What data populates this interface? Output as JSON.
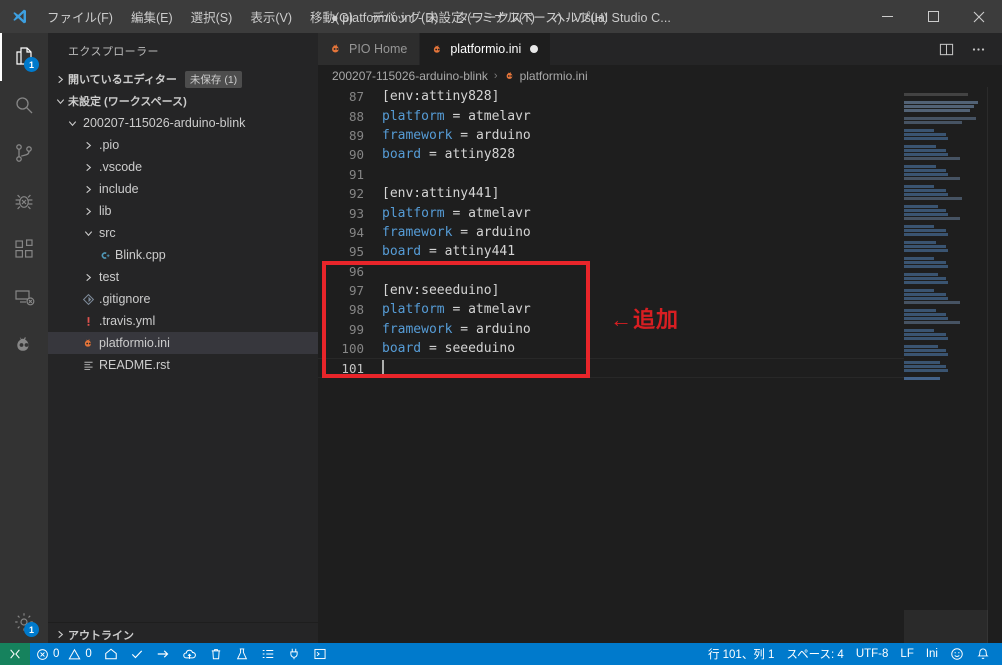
{
  "titlebar": {
    "title": "● platformio.ini - 未設定 (ワークスペース) - Visual Studio C...",
    "menu": [
      {
        "label": "ファイル(F)",
        "name": "menu-file"
      },
      {
        "label": "編集(E)",
        "name": "menu-edit"
      },
      {
        "label": "選択(S)",
        "name": "menu-selection"
      },
      {
        "label": "表示(V)",
        "name": "menu-view"
      },
      {
        "label": "移動(G)",
        "name": "menu-go"
      },
      {
        "label": "デバッグ(D)",
        "name": "menu-debug"
      },
      {
        "label": "ターミナル(T)",
        "name": "menu-terminal"
      },
      {
        "label": "ヘルプ(H)",
        "name": "menu-help"
      }
    ],
    "window_controls": {
      "minimize": "minimize-icon",
      "maximize": "maximize-icon",
      "close": "close-icon"
    }
  },
  "activitybar": {
    "items": [
      {
        "name": "explorer",
        "icon": "files-icon",
        "active": true,
        "badge": "1"
      },
      {
        "name": "search",
        "icon": "search-icon",
        "active": false,
        "badge": ""
      },
      {
        "name": "source-control",
        "icon": "source-control-icon",
        "active": false,
        "badge": ""
      },
      {
        "name": "debug",
        "icon": "debug-icon",
        "active": false,
        "badge": ""
      },
      {
        "name": "extensions",
        "icon": "extensions-icon",
        "active": false,
        "badge": ""
      },
      {
        "name": "remote-explorer",
        "icon": "remote-explorer-icon",
        "active": false,
        "badge": ""
      },
      {
        "name": "platformio",
        "icon": "platformio-alien-icon",
        "active": false,
        "badge": ""
      }
    ],
    "bottom": [
      {
        "name": "manage-settings",
        "icon": "gear-icon",
        "badge": "1"
      }
    ]
  },
  "sidebar": {
    "title": "エクスプローラー",
    "open_editors": {
      "label": "開いているエディター",
      "badge": "未保存 (1)",
      "expanded": false
    },
    "workspace": {
      "label": "未設定 (ワークスペース)",
      "expanded": true
    },
    "tree": [
      {
        "label": "200207-115026-arduino-blink",
        "depth": 1,
        "kind": "folder",
        "expanded": true,
        "icon": "chevron-down-icon",
        "selected": false
      },
      {
        "label": ".pio",
        "depth": 2,
        "kind": "folder",
        "expanded": false,
        "icon": "chevron-right-icon",
        "selected": false
      },
      {
        "label": ".vscode",
        "depth": 2,
        "kind": "folder",
        "expanded": false,
        "icon": "chevron-right-icon",
        "selected": false
      },
      {
        "label": "include",
        "depth": 2,
        "kind": "folder",
        "expanded": false,
        "icon": "chevron-right-icon",
        "selected": false
      },
      {
        "label": "lib",
        "depth": 2,
        "kind": "folder",
        "expanded": false,
        "icon": "chevron-right-icon",
        "selected": false
      },
      {
        "label": "src",
        "depth": 2,
        "kind": "folder",
        "expanded": true,
        "icon": "chevron-down-icon",
        "selected": false
      },
      {
        "label": "Blink.cpp",
        "depth": 3,
        "kind": "file",
        "icon": "cpp-file-icon",
        "selected": false
      },
      {
        "label": "test",
        "depth": 2,
        "kind": "folder",
        "expanded": false,
        "icon": "chevron-right-icon",
        "selected": false
      },
      {
        "label": ".gitignore",
        "depth": 2,
        "kind": "file",
        "icon": "git-file-icon",
        "selected": false
      },
      {
        "label": ".travis.yml",
        "depth": 2,
        "kind": "file",
        "icon": "travis-file-icon",
        "selected": false
      },
      {
        "label": "platformio.ini",
        "depth": 2,
        "kind": "file",
        "icon": "platformio-file-icon",
        "selected": true
      },
      {
        "label": "README.rst",
        "depth": 2,
        "kind": "file",
        "icon": "text-file-icon",
        "selected": false
      }
    ],
    "outline": {
      "label": "アウトライン",
      "expanded": false
    }
  },
  "editor": {
    "tabs": [
      {
        "label": "PIO Home",
        "icon": "platformio-alien-icon",
        "active": false,
        "dirty": false
      },
      {
        "label": "platformio.ini",
        "icon": "platformio-file-icon",
        "active": true,
        "dirty": true
      }
    ],
    "tab_actions": [
      {
        "name": "split-editor-button",
        "icon": "split-editor-icon"
      },
      {
        "name": "more-actions-button",
        "icon": "ellipsis-icon"
      }
    ],
    "breadcrumb": [
      "200207-115026-arduino-blink",
      "platformio.ini"
    ],
    "breadcrumb_icon": "platformio-file-icon",
    "lines": [
      {
        "no": "87",
        "kind": "section",
        "text": "[env:attiny828]"
      },
      {
        "no": "88",
        "kind": "kv",
        "key": "platform",
        "val": "atmelavr"
      },
      {
        "no": "89",
        "kind": "kv",
        "key": "framework",
        "val": "arduino"
      },
      {
        "no": "90",
        "kind": "kv",
        "key": "board",
        "val": "attiny828"
      },
      {
        "no": "91",
        "kind": "blank",
        "text": ""
      },
      {
        "no": "92",
        "kind": "section",
        "text": "[env:attiny441]"
      },
      {
        "no": "93",
        "kind": "kv",
        "key": "platform",
        "val": "atmelavr"
      },
      {
        "no": "94",
        "kind": "kv",
        "key": "framework",
        "val": "arduino"
      },
      {
        "no": "95",
        "kind": "kv",
        "key": "board",
        "val": "attiny441"
      },
      {
        "no": "96",
        "kind": "blank",
        "text": ""
      },
      {
        "no": "97",
        "kind": "section",
        "text": "[env:seeeduino]"
      },
      {
        "no": "98",
        "kind": "kv",
        "key": "platform",
        "val": "atmelavr"
      },
      {
        "no": "99",
        "kind": "kv",
        "key": "framework",
        "val": "arduino"
      },
      {
        "no": "100",
        "kind": "kv",
        "key": "board",
        "val": "seeeduino"
      },
      {
        "no": "101",
        "kind": "caret",
        "text": ""
      }
    ],
    "annotation": {
      "label": "←追加",
      "color": "#d91e22",
      "box_color": "#e8252a"
    }
  },
  "statusbar": {
    "remote_icon": "remote-window-icon",
    "left": [
      {
        "name": "problems",
        "icon": "error-icon",
        "label": "0",
        "icon2": "warning-icon",
        "label2": "0"
      },
      {
        "name": "pio-home",
        "icon": "home-icon",
        "label": ""
      },
      {
        "name": "pio-build",
        "icon": "check-icon",
        "label": ""
      },
      {
        "name": "pio-upload",
        "icon": "arrow-right-icon",
        "label": ""
      },
      {
        "name": "pio-upload-ota",
        "icon": "cloud-upload-icon",
        "label": ""
      },
      {
        "name": "pio-clean",
        "icon": "trash-icon",
        "label": ""
      },
      {
        "name": "pio-test",
        "icon": "beaker-icon",
        "label": ""
      },
      {
        "name": "pio-tasks",
        "icon": "list-icon",
        "label": ""
      },
      {
        "name": "pio-serial-monitor",
        "icon": "plug-icon",
        "label": ""
      },
      {
        "name": "pio-terminal",
        "icon": "terminal-icon",
        "label": ""
      }
    ],
    "right": [
      {
        "name": "cursor-position",
        "label": "行 101、列 1"
      },
      {
        "name": "indentation",
        "label": "スペース: 4"
      },
      {
        "name": "encoding",
        "label": "UTF-8"
      },
      {
        "name": "eol",
        "label": "LF"
      },
      {
        "name": "language-mode",
        "label": "Ini"
      },
      {
        "name": "feedback",
        "icon": "smiley-icon",
        "label": ""
      },
      {
        "name": "notifications",
        "icon": "bell-icon",
        "label": ""
      }
    ]
  },
  "colors": {
    "accent": "#007acc",
    "remote_green": "#16825d",
    "editor_bg": "#1e1e1e",
    "sidebar_bg": "#252526",
    "keyword_blue": "#569cd6"
  }
}
